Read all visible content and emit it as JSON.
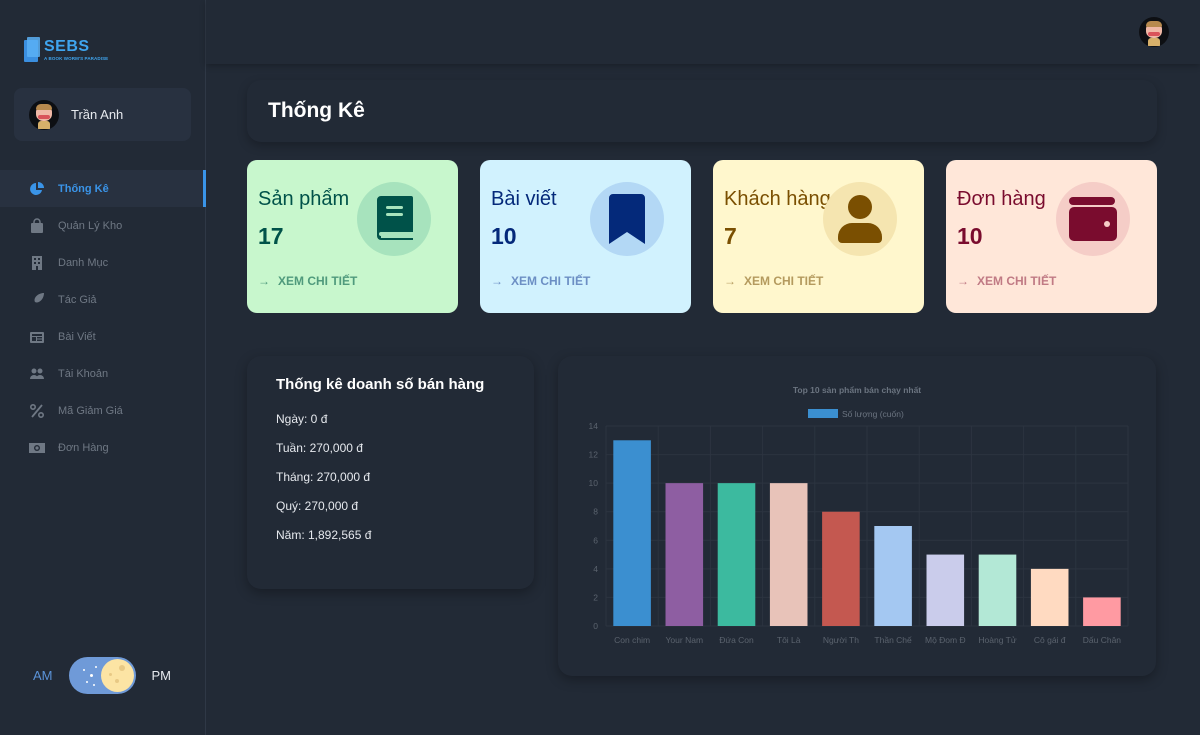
{
  "app": {
    "logo_title": "SEBS",
    "logo_subtitle": "A BOOK WORM'S PARADISE"
  },
  "user": {
    "name": "Trần Anh"
  },
  "sidebar": {
    "items": [
      {
        "label": "Thống Kê",
        "icon": "pie-chart-icon",
        "active": true
      },
      {
        "label": "Quản Lý Kho",
        "icon": "shopping-bag-icon",
        "active": false
      },
      {
        "label": "Danh Mục",
        "icon": "building-icon",
        "active": false
      },
      {
        "label": "Tác Giả",
        "icon": "feather-icon",
        "active": false
      },
      {
        "label": "Bài Viết",
        "icon": "newspaper-icon",
        "active": false
      },
      {
        "label": "Tài Khoản",
        "icon": "users-icon",
        "active": false
      },
      {
        "label": "Mã Giảm Giá",
        "icon": "percent-icon",
        "active": false
      },
      {
        "label": "Đơn Hàng",
        "icon": "money-bill-icon",
        "active": false
      }
    ]
  },
  "theme_toggle": {
    "left_label": "AM",
    "right_label": "PM",
    "state": "PM"
  },
  "page": {
    "title": "Thống Kê"
  },
  "stats": [
    {
      "label": "Sản phẩm",
      "value": "17",
      "link": "XEM CHI TIẾT",
      "icon": "book-icon",
      "bg": "#c8f7cd",
      "fg": "#005249",
      "link_color": "#4f9a7c",
      "circle": "#a7e3bd"
    },
    {
      "label": "Bài viết",
      "value": "10",
      "link": "XEM CHI TIẾT",
      "icon": "bookmark-icon",
      "bg": "#d1f2fe",
      "fg": "#04297a",
      "link_color": "#6c8fc4",
      "circle": "#b3d8f5"
    },
    {
      "label": "Khách hàng",
      "value": "7",
      "link": "XEM CHI TIẾT",
      "icon": "user-icon",
      "bg": "#fff7cd",
      "fg": "#7a4f01",
      "link_color": "#b49a5e",
      "circle": "#f5e5b0"
    },
    {
      "label": "Đơn hàng",
      "value": "10",
      "link": "XEM CHI TIẾT",
      "icon": "wallet-icon",
      "bg": "#ffe7d9",
      "fg": "#7a0c2e",
      "link_color": "#c07a84",
      "circle": "#f5cdc7"
    }
  ],
  "sales": {
    "title": "Thống kê doanh số bán hàng",
    "rows": [
      "Ngày: 0 đ",
      "Tuần: 270,000 đ",
      "Tháng: 270,000 đ",
      "Quý: 270,000 đ",
      "Năm: 1,892,565 đ"
    ]
  },
  "chart_data": {
    "type": "bar",
    "title": "Top 10 sản phẩm bán chạy nhất",
    "legend": [
      {
        "label": "Số lượng (cuốn)",
        "color": "#3b8fd0"
      }
    ],
    "legend_position": "top-center",
    "categories": [
      "Con chim",
      "Your Nam",
      "Đứa Con",
      "Tôi Là",
      "Người Th",
      "Thần Chế",
      "Mộ Đom Đ",
      "Hoàng Tử",
      "Cô gái đ",
      "Dấu Chân"
    ],
    "series": [
      {
        "name": "Số lượng (cuốn)",
        "values": [
          13,
          10,
          10,
          10,
          8,
          7,
          5,
          5,
          4,
          2
        ]
      }
    ],
    "colors": [
      "#3b8fd0",
      "#8e5ea2",
      "#3cba9f",
      "#e8c3b9",
      "#c45850",
      "#a4c8f2",
      "#cacceb",
      "#b3e8d6",
      "#ffdac1",
      "#ff9aa2"
    ],
    "yticks": [
      0,
      2,
      4,
      6,
      8,
      10,
      12,
      14
    ],
    "ylim": [
      0,
      14
    ],
    "xlabel": "",
    "ylabel": "",
    "grid": true
  }
}
